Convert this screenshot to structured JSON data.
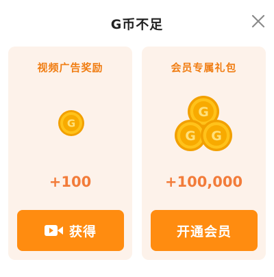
{
  "dialog": {
    "title": "G币不足",
    "close_icon": "close-icon"
  },
  "cards": [
    {
      "title": "视频广告奖励",
      "amount": "+100",
      "button_label": "获得",
      "button_icon": "video-camera-icon",
      "image": "single-g-coin-icon"
    },
    {
      "title": "会员专属礼包",
      "amount": "+100,000",
      "button_label": "开通会员",
      "image": "g-coin-stack-icon"
    }
  ],
  "colors": {
    "card_bg": "#fdf2ea",
    "accent_orange": "#ff8c10",
    "title_orange": "#f07d12",
    "amount_orange": "#f27c3a",
    "coin_gold": "#f7b500"
  }
}
